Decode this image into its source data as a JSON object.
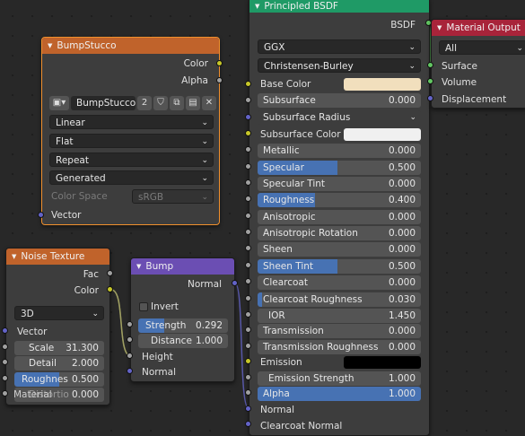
{
  "colors": {
    "socket_color": "#c7c729",
    "socket_float": "#a1a1a1",
    "socket_vector": "#6363c7",
    "socket_shader": "#63c763",
    "accent": "#4772b3",
    "header_texture": "#c0632b",
    "header_vector": "#6b4eb3",
    "header_shader": "#1f9a66",
    "header_output": "#a8243a"
  },
  "bumpstucco": {
    "title": "BumpStucco",
    "out_color": "Color",
    "out_alpha": "Alpha",
    "image_name": "BumpStucco",
    "users": "2",
    "interpolation": "Linear",
    "projection": "Flat",
    "extension": "Repeat",
    "source": "Generated",
    "color_space_label": "Color Space",
    "color_space_value": "sRGB",
    "in_vector": "Vector"
  },
  "noise": {
    "title": "Noise Texture",
    "out_fac": "Fac",
    "out_color": "Color",
    "dimensions": "3D",
    "in_vector": "Vector",
    "scale_label": "Scale",
    "scale_value": "31.300",
    "detail_label": "Detail",
    "detail_value": "2.000",
    "roughness_label": "Roughnes",
    "roughness_value": "0.500",
    "distortion_label": "Distortio",
    "distortion_value": "0.000",
    "overlap_label": "Material"
  },
  "bump": {
    "title": "Bump",
    "out_normal": "Normal",
    "invert_label": "Invert",
    "strength_label": "Strength",
    "strength_value": "0.292",
    "distance_label": "Distance",
    "distance_value": "1.000",
    "in_height": "Height",
    "in_normal": "Normal"
  },
  "principled": {
    "title": "Principled BSDF",
    "out_bsdf": "BSDF",
    "distribution": "GGX",
    "subsurface_method": "Christensen-Burley",
    "base_color_label": "Base Color",
    "subsurface_label": "Subsurface",
    "subsurface_value": "0.000",
    "subsurface_radius_label": "Subsurface Radius",
    "subsurface_color_label": "Subsurface Color",
    "metallic_label": "Metallic",
    "metallic_value": "0.000",
    "specular_label": "Specular",
    "specular_value": "0.500",
    "specular_tint_label": "Specular Tint",
    "specular_tint_value": "0.000",
    "roughness_label": "Roughness",
    "roughness_value": "0.400",
    "anisotropic_label": "Anisotropic",
    "anisotropic_value": "0.000",
    "anisotropic_rotation_label": "Anisotropic Rotation",
    "anisotropic_rotation_value": "0.000",
    "sheen_label": "Sheen",
    "sheen_value": "0.000",
    "sheen_tint_label": "Sheen Tint",
    "sheen_tint_value": "0.500",
    "clearcoat_label": "Clearcoat",
    "clearcoat_value": "0.000",
    "clearcoat_roughness_label": "Clearcoat Roughness",
    "clearcoat_roughness_value": "0.030",
    "ior_label": "IOR",
    "ior_value": "1.450",
    "transmission_label": "Transmission",
    "transmission_value": "0.000",
    "transmission_roughness_label": "Transmission Roughness",
    "transmission_roughness_value": "0.000",
    "emission_label": "Emission",
    "emission_strength_label": "Emission Strength",
    "emission_strength_value": "1.000",
    "alpha_label": "Alpha",
    "alpha_value": "1.000",
    "normal_label": "Normal",
    "clearcoat_normal_label": "Clearcoat Normal",
    "base_color_swatch": "#f1dfbd",
    "subsurface_color_swatch": "#f0f0f0",
    "emission_swatch": "#000000"
  },
  "output": {
    "title": "Material Output",
    "target": "All",
    "in_surface": "Surface",
    "in_volume": "Volume",
    "in_displacement": "Displacement"
  }
}
